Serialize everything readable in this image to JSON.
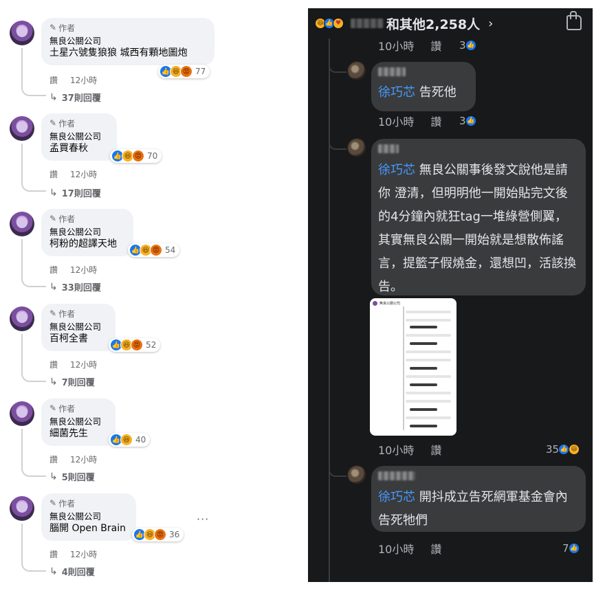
{
  "left_comments": [
    {
      "badge": "作者",
      "page_name": "無良公關公司",
      "text": "土星六號隻狼狼 城西有顆地圖炮",
      "reaction_count": "77",
      "reactions": [
        "like",
        "haha",
        "angry"
      ],
      "action": "讚",
      "time": "12小時",
      "replies": "37則回覆"
    },
    {
      "badge": "作者",
      "page_name": "無良公關公司",
      "text": "孟買春秋",
      "reaction_count": "70",
      "reactions": [
        "like",
        "haha",
        "angry"
      ],
      "action": "讚",
      "time": "12小時",
      "replies": "17則回覆"
    },
    {
      "badge": "作者",
      "page_name": "無良公關公司",
      "text": "柯粉的超譯天地",
      "reaction_count": "54",
      "reactions": [
        "like",
        "haha",
        "angry"
      ],
      "action": "讚",
      "time": "12小時",
      "replies": "33則回覆"
    },
    {
      "badge": "作者",
      "page_name": "無良公關公司",
      "text": "百柯全書",
      "reaction_count": "52",
      "reactions": [
        "like",
        "haha",
        "angry"
      ],
      "action": "讚",
      "time": "12小時",
      "replies": "7則回覆"
    },
    {
      "badge": "作者",
      "page_name": "無良公關公司",
      "text": "細菌先生",
      "reaction_count": "40",
      "reactions": [
        "like",
        "haha"
      ],
      "action": "讚",
      "time": "12小時",
      "replies": "5則回覆"
    },
    {
      "badge": "作者",
      "page_name": "無良公關公司",
      "text": "腦開 Open Brain",
      "reaction_count": "36",
      "reactions": [
        "like",
        "haha",
        "angry"
      ],
      "action": "讚",
      "time": "12小時",
      "replies": "4則回覆"
    }
  ],
  "right_panel": {
    "others_text": "和其他2,258人",
    "chevron": "›",
    "top_meta": {
      "time": "10小時",
      "action": "讚",
      "count": "3"
    },
    "comments": [
      {
        "tag": "徐巧芯",
        "text": " 告死他",
        "time": "10小時",
        "action": "讚",
        "count": "3"
      },
      {
        "tag": "徐巧芯",
        "text": " 無良公關事後發文說他是請 你 澄清，但明明他一開始貼完文後的4分鐘內就狂tag一堆綠營側翼，其實無良公關一開始就是想散佈謠言，提籃子假燒金，還想凹，活該換告。",
        "time": "10小時",
        "action": "讚",
        "count": "35",
        "screenshot_title": "無良公關公司"
      },
      {
        "tag": "徐巧芯",
        "text": " 開抖成立告死網軍基金會內告死牠們",
        "time": "10小時",
        "action": "讚",
        "count": "7"
      }
    ]
  },
  "colors": {
    "accent": "#1877f2",
    "tag_blue": "#4599ff",
    "dark_bg": "#18191a",
    "dark_bubble": "#3a3b3c",
    "light_bubble": "#f0f2f5"
  }
}
